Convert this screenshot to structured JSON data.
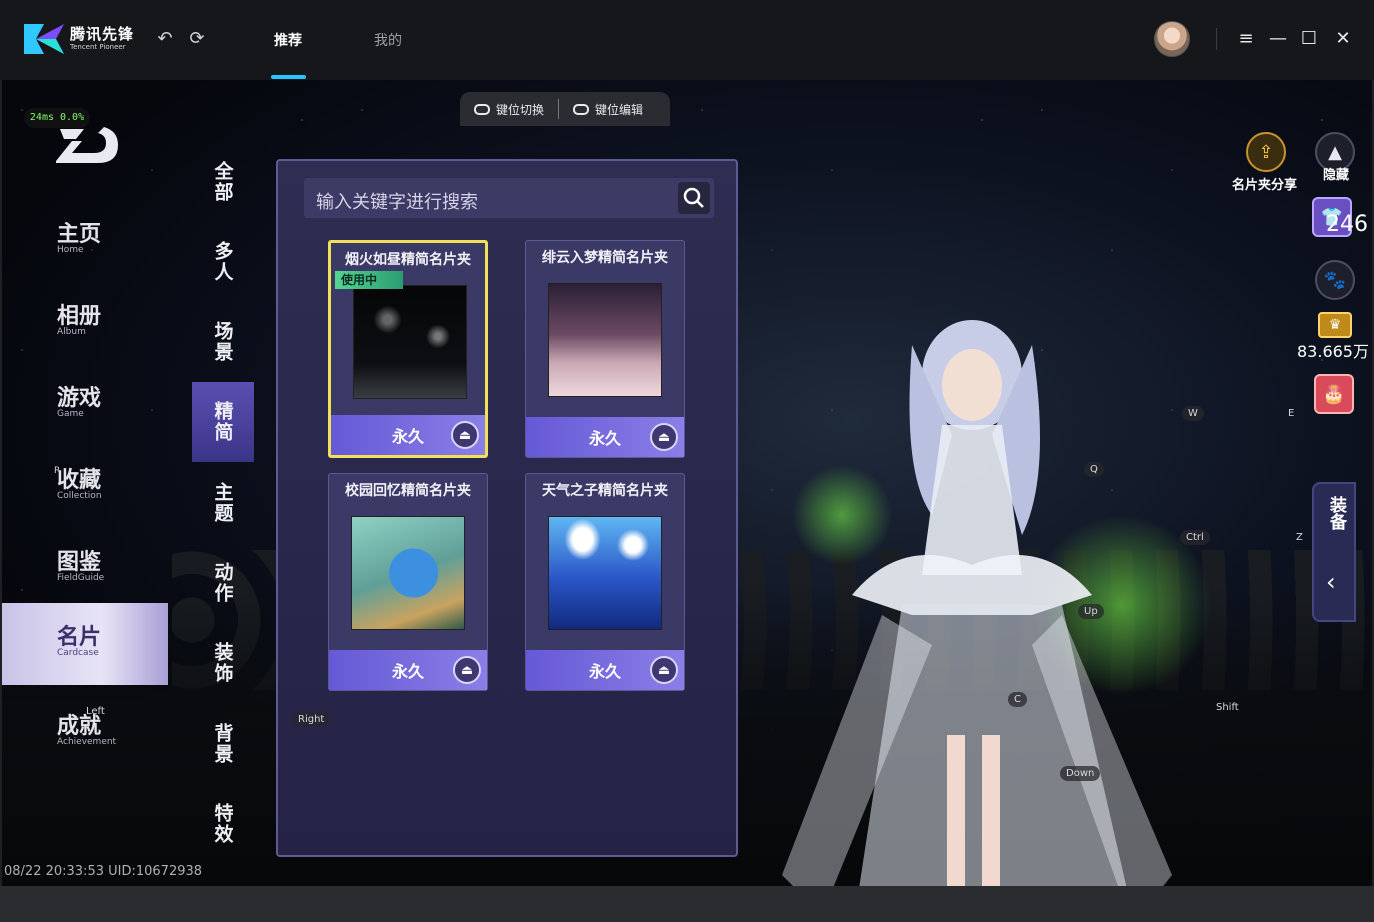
{
  "titlebar": {
    "logo_cn": "腾讯先锋",
    "logo_en": "Tencent Pioneer",
    "tabs": [
      {
        "label": "推荐",
        "active": true
      },
      {
        "label": "我的",
        "active": false
      }
    ],
    "accent_color": "#27c4ff"
  },
  "game": {
    "top_keys": [
      {
        "label": "键位切换"
      },
      {
        "label": "键位编辑"
      }
    ],
    "ping": "24ms  0.0%",
    "nav": [
      {
        "cn": "主页",
        "en": "Home"
      },
      {
        "cn": "相册",
        "en": "Album"
      },
      {
        "cn": "游戏",
        "en": "Game"
      },
      {
        "cn": "收藏",
        "en": "Collection"
      },
      {
        "cn": "图鉴",
        "en": "FieldGuide"
      },
      {
        "cn": "名片",
        "en": "Cardcase",
        "active": true
      },
      {
        "cn": "成就",
        "en": "Achievement"
      }
    ],
    "categories": [
      {
        "label": "全部"
      },
      {
        "label": "多人"
      },
      {
        "label": "场景"
      },
      {
        "label": "精简",
        "active": true
      },
      {
        "label": "主题"
      },
      {
        "label": "动作"
      },
      {
        "label": "装饰"
      },
      {
        "label": "背景"
      },
      {
        "label": "特效"
      }
    ],
    "search": {
      "placeholder": "输入关键字进行搜索"
    },
    "cards": [
      {
        "title": "烟火如昼精简名片夹",
        "price": "永久",
        "in_use": "使用中",
        "selected": true
      },
      {
        "title": "绯云入梦精简名片夹",
        "price": "永久"
      },
      {
        "title": "校园回忆精简名片夹",
        "price": "永久"
      },
      {
        "title": "天气之子精简名片夹",
        "price": "永久"
      }
    ],
    "hud": {
      "share_label": "名片夹分享",
      "hide_label": "隐藏",
      "outfit_count": "246",
      "coins": "83.665万",
      "drawer_label": "装备"
    },
    "key_hints": {
      "w": "W",
      "e": "E",
      "q": "Q",
      "ctrl": "Ctrl",
      "z": "Z",
      "up": "Up",
      "c": "C",
      "shift": "Shift",
      "down": "Down",
      "right": "Right",
      "left": "Left",
      "r": "R"
    },
    "status": "08/22 20:33:53 UID:10672938"
  }
}
